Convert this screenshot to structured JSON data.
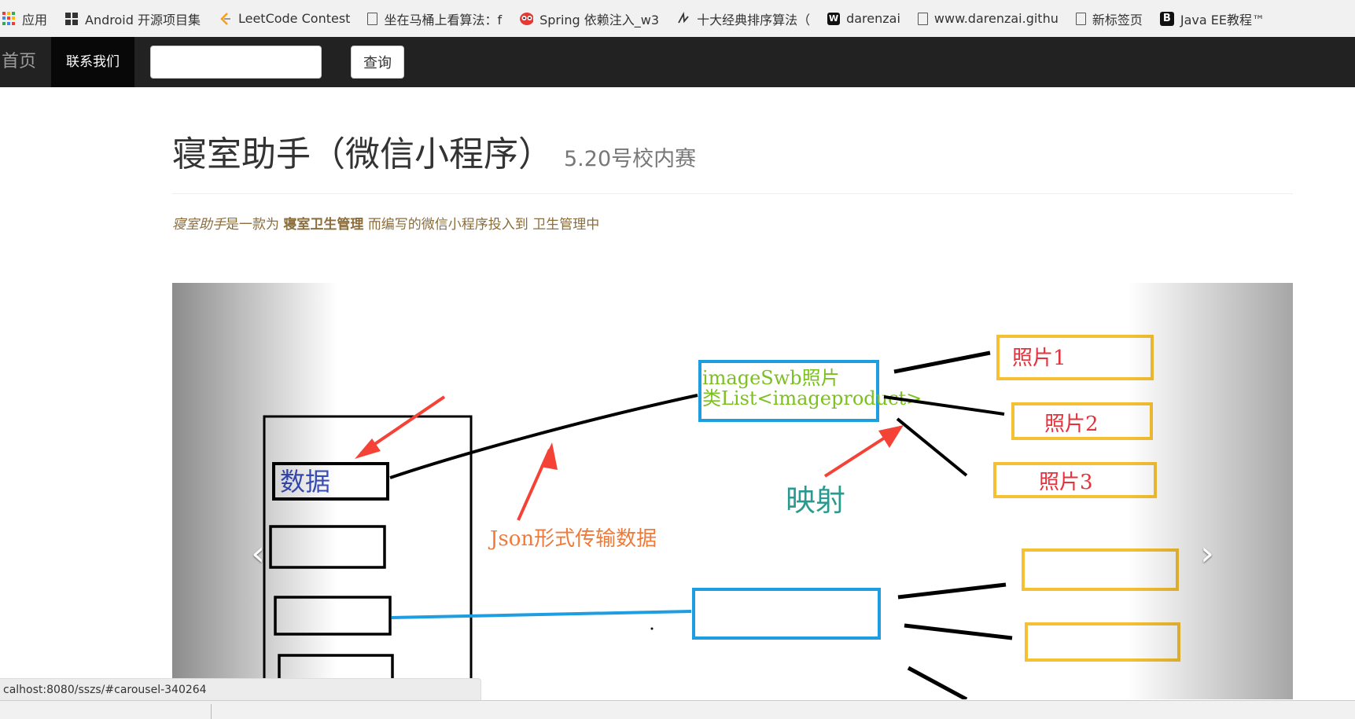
{
  "bookmarks": [
    {
      "label": "应用",
      "icon": "apps-grid-icon"
    },
    {
      "label": "Android 开源项目集",
      "icon": "android-project-icon"
    },
    {
      "label": "LeetCode Contest",
      "icon": "leetcode-icon"
    },
    {
      "label": "坐在马桶上看算法：f",
      "icon": "page-icon"
    },
    {
      "label": "Spring 依赖注入_w3",
      "icon": "owl-icon"
    },
    {
      "label": "十大经典排序算法（",
      "icon": "script-icon"
    },
    {
      "label": "darenzai",
      "icon": "w-logo-icon"
    },
    {
      "label": "www.darenzai.githu",
      "icon": "page-icon"
    },
    {
      "label": "新标签页",
      "icon": "page-icon"
    },
    {
      "label": "Java EE教程™",
      "icon": "b-logo-icon"
    }
  ],
  "navbar": {
    "home": "首页",
    "contact": "联系我们",
    "search_value": "",
    "search_button": "查询"
  },
  "header": {
    "title": "寝室助手（微信小程序）",
    "subtitle": "5.20号校内赛"
  },
  "intro": {
    "em": "寝室助手",
    "text1": "是一款为",
    "strong": "寝室卫生管理",
    "text2": "而编写的微信小程序投入到 卫生管理中"
  },
  "carousel": {
    "diagram": {
      "data_label": "数据",
      "class_line1": "imageSwb照片",
      "class_line2": "类List<imageproduct>",
      "json_label": "Json形式传输数据",
      "mapping_label": "映射",
      "photo1": "照片1",
      "photo2": "照片2",
      "photo3": "照片3"
    },
    "prev_icon": "chevron-left-icon",
    "next_icon": "chevron-right-icon"
  },
  "status_url": "calhost:8080/sszs/#carousel-340264",
  "colors": {
    "navbar": "#222222",
    "blue_box": "#1e9ee0",
    "yellow_box": "#f5c033",
    "red_arrow": "#f44336",
    "green_text": "#7cc020",
    "orange_text": "#f07a3a",
    "teal_text": "#2a9a8f",
    "photo_text": "#e8303a"
  }
}
